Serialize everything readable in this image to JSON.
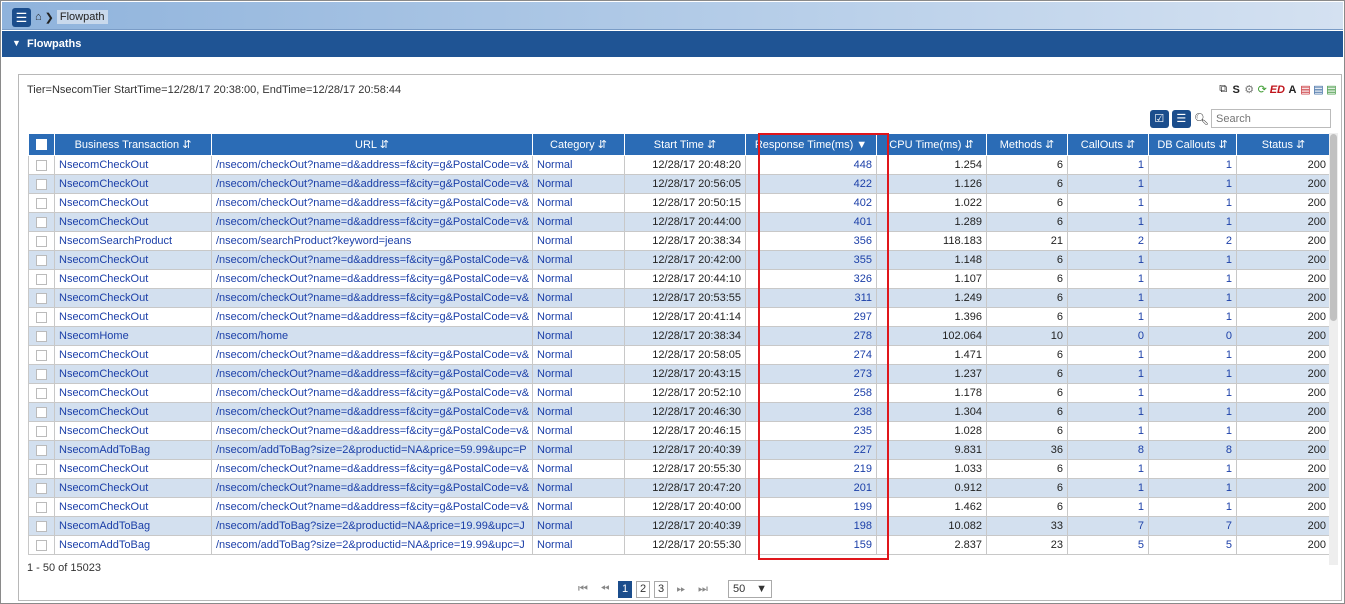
{
  "nav": {
    "breadcrumb_current": "Flowpath"
  },
  "section": {
    "title": "Flowpaths"
  },
  "info": {
    "line": "Tier=NsecomTier StartTime=12/28/17 20:38:00, EndTime=12/28/17 20:58:44"
  },
  "export_icons": [
    "copy-icon",
    "S",
    "gear-icon",
    "refresh-icon",
    "ED",
    "A",
    "pdf-icon",
    "word-icon",
    "excel-icon"
  ],
  "search": {
    "placeholder": "Search"
  },
  "columns": [
    "Business Transaction",
    "URL",
    "Category",
    "Start Time",
    "Response Time(ms)",
    "CPU Time(ms)",
    "Methods",
    "CallOuts",
    "DB Callouts",
    "Status"
  ],
  "rows": [
    {
      "bt": "NsecomCheckOut",
      "url": "/nsecom/checkOut?name=d&address=f&city=g&PostalCode=v&",
      "cat": "Normal",
      "start": "12/28/17 20:48:20",
      "resp": "448",
      "cpu": "1.254",
      "methods": "6",
      "callouts": "1",
      "db": "1",
      "status": "200"
    },
    {
      "bt": "NsecomCheckOut",
      "url": "/nsecom/checkOut?name=d&address=f&city=g&PostalCode=v&",
      "cat": "Normal",
      "start": "12/28/17 20:56:05",
      "resp": "422",
      "cpu": "1.126",
      "methods": "6",
      "callouts": "1",
      "db": "1",
      "status": "200"
    },
    {
      "bt": "NsecomCheckOut",
      "url": "/nsecom/checkOut?name=d&address=f&city=g&PostalCode=v&",
      "cat": "Normal",
      "start": "12/28/17 20:50:15",
      "resp": "402",
      "cpu": "1.022",
      "methods": "6",
      "callouts": "1",
      "db": "1",
      "status": "200"
    },
    {
      "bt": "NsecomCheckOut",
      "url": "/nsecom/checkOut?name=d&address=f&city=g&PostalCode=v&",
      "cat": "Normal",
      "start": "12/28/17 20:44:00",
      "resp": "401",
      "cpu": "1.289",
      "methods": "6",
      "callouts": "1",
      "db": "1",
      "status": "200"
    },
    {
      "bt": "NsecomSearchProduct",
      "url": "/nsecom/searchProduct?keyword=jeans",
      "cat": "Normal",
      "start": "12/28/17 20:38:34",
      "resp": "356",
      "cpu": "118.183",
      "methods": "21",
      "callouts": "2",
      "db": "2",
      "status": "200"
    },
    {
      "bt": "NsecomCheckOut",
      "url": "/nsecom/checkOut?name=d&address=f&city=g&PostalCode=v&",
      "cat": "Normal",
      "start": "12/28/17 20:42:00",
      "resp": "355",
      "cpu": "1.148",
      "methods": "6",
      "callouts": "1",
      "db": "1",
      "status": "200"
    },
    {
      "bt": "NsecomCheckOut",
      "url": "/nsecom/checkOut?name=d&address=f&city=g&PostalCode=v&",
      "cat": "Normal",
      "start": "12/28/17 20:44:10",
      "resp": "326",
      "cpu": "1.107",
      "methods": "6",
      "callouts": "1",
      "db": "1",
      "status": "200"
    },
    {
      "bt": "NsecomCheckOut",
      "url": "/nsecom/checkOut?name=d&address=f&city=g&PostalCode=v&",
      "cat": "Normal",
      "start": "12/28/17 20:53:55",
      "resp": "311",
      "cpu": "1.249",
      "methods": "6",
      "callouts": "1",
      "db": "1",
      "status": "200"
    },
    {
      "bt": "NsecomCheckOut",
      "url": "/nsecom/checkOut?name=d&address=f&city=g&PostalCode=v&",
      "cat": "Normal",
      "start": "12/28/17 20:41:14",
      "resp": "297",
      "cpu": "1.396",
      "methods": "6",
      "callouts": "1",
      "db": "1",
      "status": "200"
    },
    {
      "bt": "NsecomHome",
      "url": "/nsecom/home",
      "cat": "Normal",
      "start": "12/28/17 20:38:34",
      "resp": "278",
      "cpu": "102.064",
      "methods": "10",
      "callouts": "0",
      "db": "0",
      "status": "200"
    },
    {
      "bt": "NsecomCheckOut",
      "url": "/nsecom/checkOut?name=d&address=f&city=g&PostalCode=v&",
      "cat": "Normal",
      "start": "12/28/17 20:58:05",
      "resp": "274",
      "cpu": "1.471",
      "methods": "6",
      "callouts": "1",
      "db": "1",
      "status": "200"
    },
    {
      "bt": "NsecomCheckOut",
      "url": "/nsecom/checkOut?name=d&address=f&city=g&PostalCode=v&",
      "cat": "Normal",
      "start": "12/28/17 20:43:15",
      "resp": "273",
      "cpu": "1.237",
      "methods": "6",
      "callouts": "1",
      "db": "1",
      "status": "200"
    },
    {
      "bt": "NsecomCheckOut",
      "url": "/nsecom/checkOut?name=d&address=f&city=g&PostalCode=v&",
      "cat": "Normal",
      "start": "12/28/17 20:52:10",
      "resp": "258",
      "cpu": "1.178",
      "methods": "6",
      "callouts": "1",
      "db": "1",
      "status": "200"
    },
    {
      "bt": "NsecomCheckOut",
      "url": "/nsecom/checkOut?name=d&address=f&city=g&PostalCode=v&",
      "cat": "Normal",
      "start": "12/28/17 20:46:30",
      "resp": "238",
      "cpu": "1.304",
      "methods": "6",
      "callouts": "1",
      "db": "1",
      "status": "200"
    },
    {
      "bt": "NsecomCheckOut",
      "url": "/nsecom/checkOut?name=d&address=f&city=g&PostalCode=v&",
      "cat": "Normal",
      "start": "12/28/17 20:46:15",
      "resp": "235",
      "cpu": "1.028",
      "methods": "6",
      "callouts": "1",
      "db": "1",
      "status": "200"
    },
    {
      "bt": "NsecomAddToBag",
      "url": "/nsecom/addToBag?size=2&productid=NA&price=59.99&upc=P",
      "cat": "Normal",
      "start": "12/28/17 20:40:39",
      "resp": "227",
      "cpu": "9.831",
      "methods": "36",
      "callouts": "8",
      "db": "8",
      "status": "200"
    },
    {
      "bt": "NsecomCheckOut",
      "url": "/nsecom/checkOut?name=d&address=f&city=g&PostalCode=v&",
      "cat": "Normal",
      "start": "12/28/17 20:55:30",
      "resp": "219",
      "cpu": "1.033",
      "methods": "6",
      "callouts": "1",
      "db": "1",
      "status": "200"
    },
    {
      "bt": "NsecomCheckOut",
      "url": "/nsecom/checkOut?name=d&address=f&city=g&PostalCode=v&",
      "cat": "Normal",
      "start": "12/28/17 20:47:20",
      "resp": "201",
      "cpu": "0.912",
      "methods": "6",
      "callouts": "1",
      "db": "1",
      "status": "200"
    },
    {
      "bt": "NsecomCheckOut",
      "url": "/nsecom/checkOut?name=d&address=f&city=g&PostalCode=v&",
      "cat": "Normal",
      "start": "12/28/17 20:40:00",
      "resp": "199",
      "cpu": "1.462",
      "methods": "6",
      "callouts": "1",
      "db": "1",
      "status": "200"
    },
    {
      "bt": "NsecomAddToBag",
      "url": "/nsecom/addToBag?size=2&productid=NA&price=19.99&upc=J",
      "cat": "Normal",
      "start": "12/28/17 20:40:39",
      "resp": "198",
      "cpu": "10.082",
      "methods": "33",
      "callouts": "7",
      "db": "7",
      "status": "200"
    },
    {
      "bt": "NsecomAddToBag",
      "url": "/nsecom/addToBag?size=2&productid=NA&price=19.99&upc=J",
      "cat": "Normal",
      "start": "12/28/17 20:55:30",
      "resp": "159",
      "cpu": "2.837",
      "methods": "23",
      "callouts": "5",
      "db": "5",
      "status": "200"
    }
  ],
  "range_text": "1 - 50 of 15023",
  "pager": {
    "pages": [
      "1",
      "2",
      "3"
    ],
    "active": "1",
    "page_size": "50"
  },
  "colors": {
    "header_bg": "#2b6cb6",
    "section_bg": "#1f5494",
    "row_alt": "#d3e0ef",
    "highlight": "#e0161b"
  }
}
